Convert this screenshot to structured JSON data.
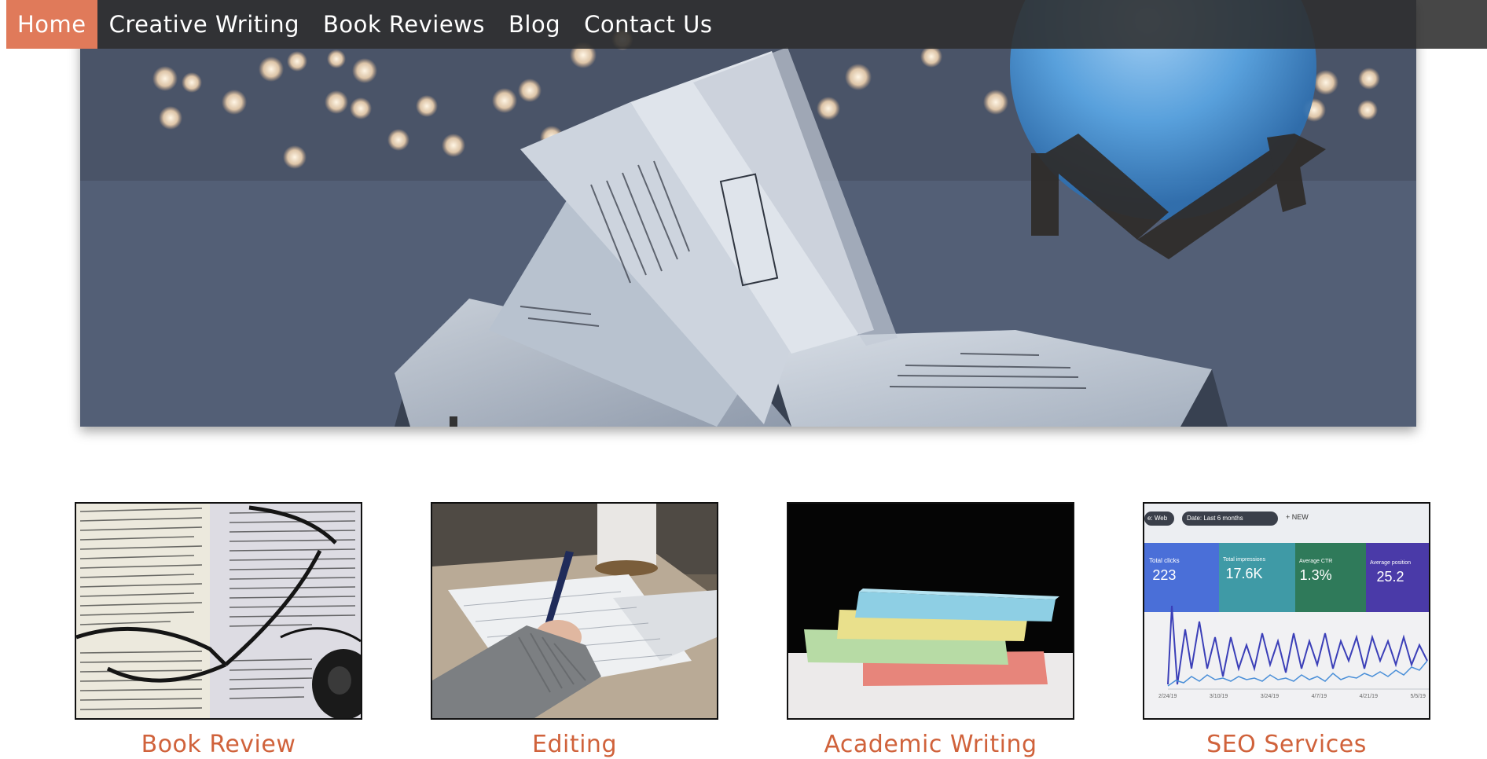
{
  "nav": {
    "items": [
      {
        "label": "Home",
        "active": true
      },
      {
        "label": "Creative Writing",
        "active": false
      },
      {
        "label": "Book Reviews",
        "active": false
      },
      {
        "label": "Blog",
        "active": false
      },
      {
        "label": "Contact Us",
        "active": false
      }
    ]
  },
  "services": [
    {
      "label": "Book Review",
      "image": "glasses-on-book-photo"
    },
    {
      "label": "Editing",
      "image": "hand-writing-with-pen-photo"
    },
    {
      "label": "Academic Writing",
      "image": "stack-of-colored-notepads-photo"
    },
    {
      "label": "SEO Services",
      "image": "analytics-dashboard-photo",
      "dashboard": {
        "filter_chip": "e: Web",
        "date_chip": "Date: Last 6 months",
        "new_label": "NEW",
        "metrics": [
          {
            "label": "Total clicks",
            "value": "223",
            "color": "#4a6fd8"
          },
          {
            "label": "Total impressions",
            "value": "17.6K",
            "color": "#3f9aa6"
          },
          {
            "label": "Average CTR",
            "value": "1.3%",
            "color": "#2f7a5a"
          },
          {
            "label": "Average position",
            "value": "25.2",
            "color": "#4a3aa8"
          }
        ],
        "dates": [
          "2/24/19",
          "3/10/19",
          "3/24/19",
          "4/7/19",
          "4/21/19",
          "5/5/19"
        ]
      }
    }
  ],
  "colors": {
    "accent": "#e07a5a",
    "label": "#d0623b",
    "nav_bg": "#2d2d2d"
  }
}
